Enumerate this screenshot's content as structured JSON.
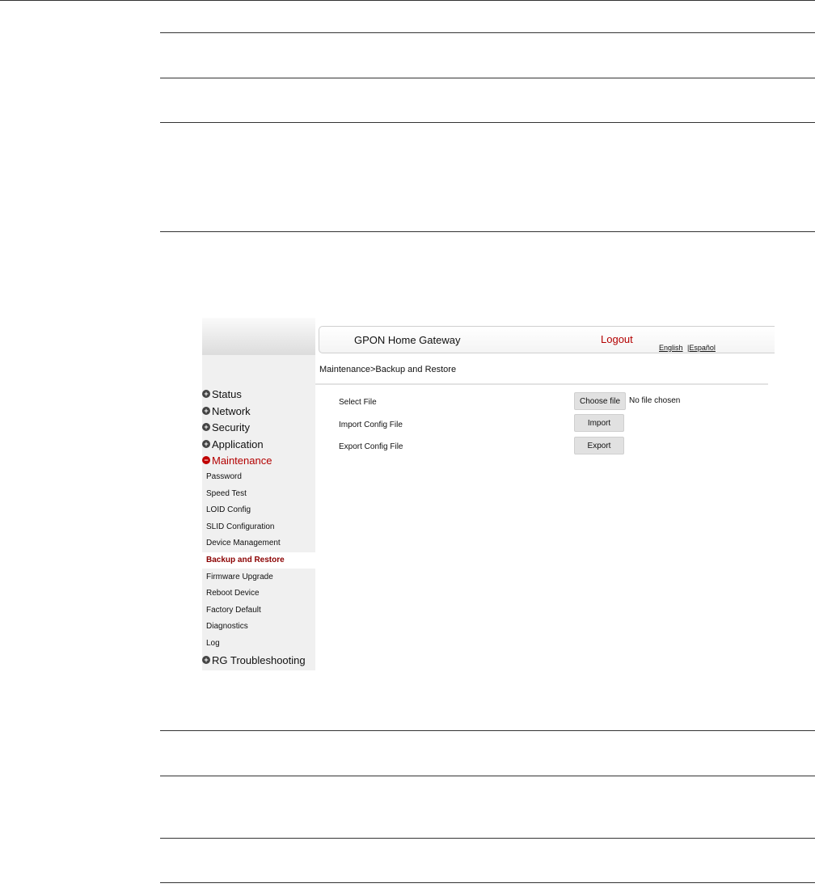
{
  "app": {
    "brand": "GPON Home Gateway",
    "logout": "Logout",
    "lang_english": "English",
    "lang_sep": "|",
    "lang_spanish": "Español"
  },
  "breadcrumb": "Maintenance>Backup and Restore",
  "sidebar": {
    "top": [
      {
        "label": "Status"
      },
      {
        "label": "Network"
      },
      {
        "label": "Security"
      },
      {
        "label": "Application"
      },
      {
        "label": "Maintenance"
      }
    ],
    "maintenance_items": [
      {
        "label": "Password"
      },
      {
        "label": "Speed Test"
      },
      {
        "label": "LOID Config"
      },
      {
        "label": "SLID Configuration"
      },
      {
        "label": "Device Management"
      },
      {
        "label": "Backup and Restore"
      },
      {
        "label": "Firmware Upgrade"
      },
      {
        "label": "Reboot Device"
      },
      {
        "label": "Factory Default"
      },
      {
        "label": "Diagnostics"
      },
      {
        "label": "Log"
      }
    ],
    "bottom": {
      "label": "RG Troubleshooting"
    },
    "active_section": "Maintenance",
    "active_item": "Backup and Restore"
  },
  "form": {
    "select_file_label": "Select File",
    "choose_file_button": "Choose file",
    "file_status": "No file chosen",
    "import_label": "Import Config File",
    "import_button": "Import",
    "export_label": "Export Config File",
    "export_button": "Export"
  },
  "colors": {
    "accent_red": "#b30000",
    "sidebar_bg": "#f0f0f0",
    "button_bg": "#e1e1e1"
  }
}
